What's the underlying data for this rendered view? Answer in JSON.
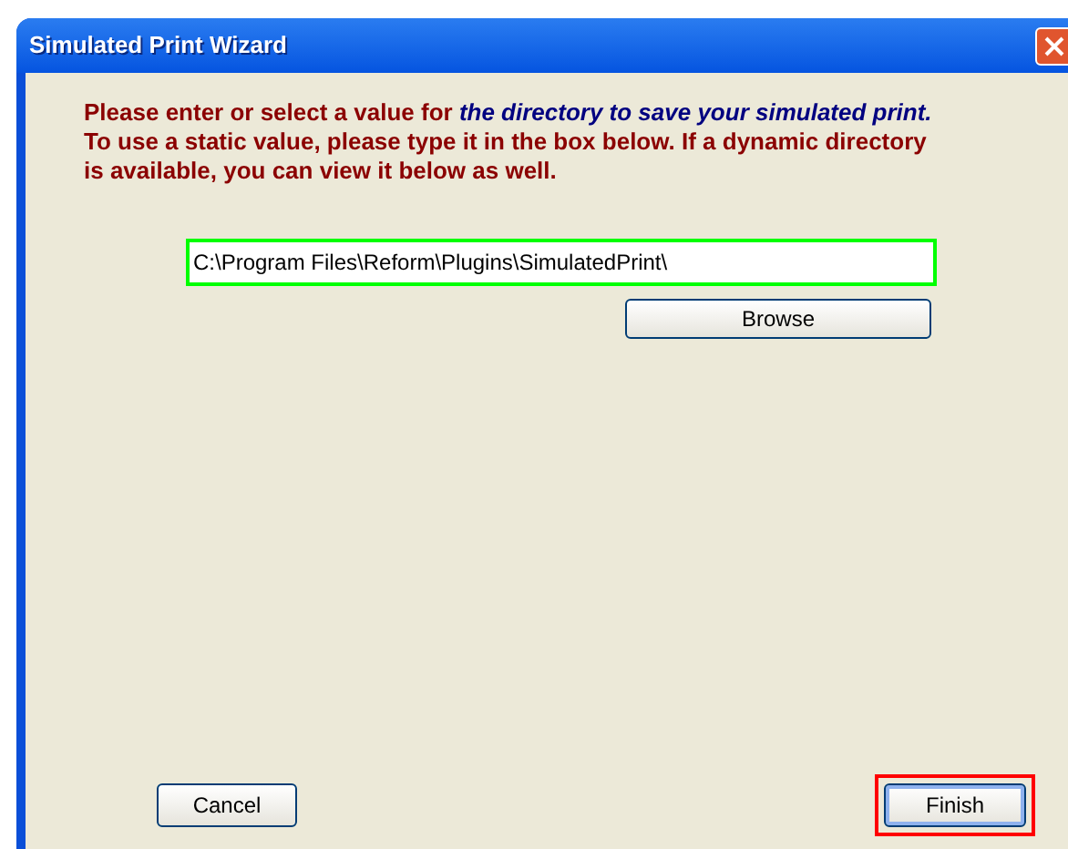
{
  "window": {
    "title": "Simulated Print Wizard"
  },
  "prompt": {
    "lead": "Please enter or select a value for ",
    "target": "the directory to save your simulated print.",
    "instructions": "To use a static value, please type it in the box below.  If a dynamic directory is available, you can view it below as well."
  },
  "path_field": {
    "value": "C:\\Program Files\\Reform\\Plugins\\SimulatedPrint\\",
    "highlighted": true
  },
  "browse_button": {
    "label": "Browse"
  },
  "buttons": [
    {
      "label": "Cancel",
      "highlighted": false
    },
    {
      "label": "Finish",
      "highlighted": true
    }
  ]
}
